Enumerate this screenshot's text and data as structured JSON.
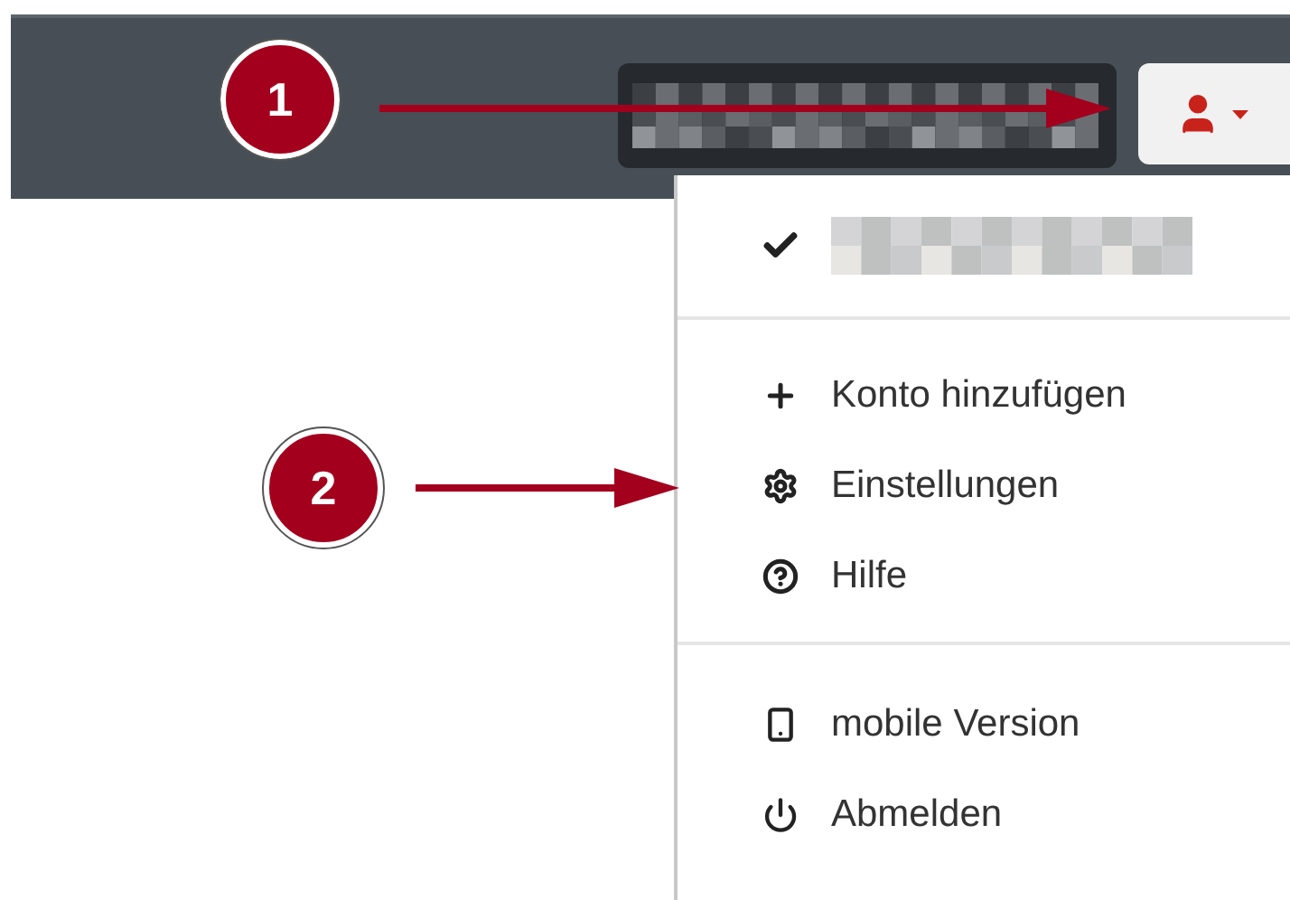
{
  "annotations": [
    {
      "label": "1"
    },
    {
      "label": "2"
    }
  ],
  "account_menu": {
    "checked": true,
    "items": [
      {
        "label": "Konto hinzufügen"
      },
      {
        "label": "Einstellungen"
      },
      {
        "label": "Hilfe"
      }
    ],
    "footer_items": [
      {
        "label": "mobile Version"
      },
      {
        "label": "Abmelden"
      }
    ]
  }
}
